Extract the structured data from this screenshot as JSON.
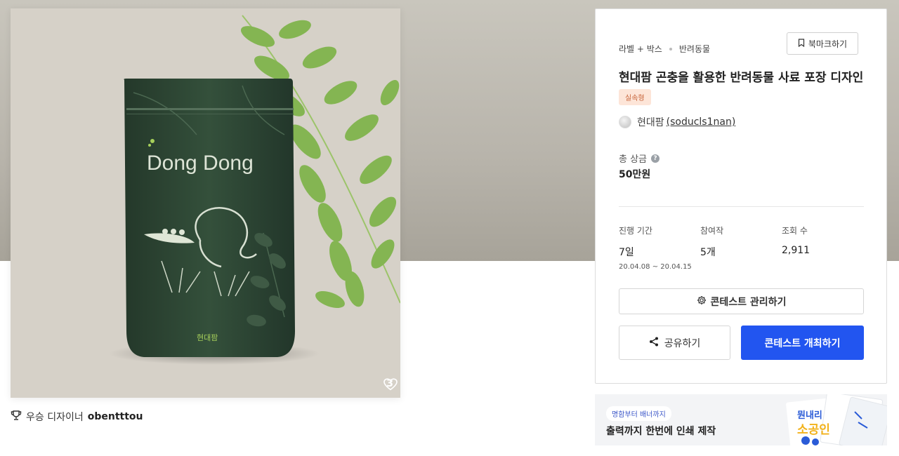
{
  "hero": {
    "brand_text": "Dong Dong",
    "logo_text": "현대팜",
    "like_count": "3"
  },
  "winner": {
    "label": "우승 디자이너",
    "name": "obentttou"
  },
  "panel": {
    "breadcrumb": [
      "라벨 + 박스",
      "반려동물"
    ],
    "bookmark_label": "북마크하기",
    "title": "현대팜 곤충을 활용한 반려동물 사료 포장 디자인",
    "badge": "실속형",
    "author_name": "현대팜",
    "author_handle": "(soducls1nan)",
    "prize_label": "총 상금",
    "prize_help": "?",
    "prize_value": "50만원",
    "stats": [
      {
        "label": "진행 기간",
        "value": "7일",
        "sub": "20.04.08 ~ 20.04.15"
      },
      {
        "label": "참여작",
        "value": "5개"
      },
      {
        "label": "조회 수",
        "value": "2,911"
      }
    ],
    "manage_label": "콘테스트 관리하기",
    "share_label": "공유하기",
    "host_label": "콘테스트 개최하기"
  },
  "banner": {
    "tag": "명함부터 배너까지",
    "text": "출력까지 한번에 인쇄 제작",
    "art_line1": "뭔내리",
    "art_line2": "소공인"
  },
  "icons": {
    "like": "heart-icon",
    "trophy": "trophy-icon",
    "bookmark": "bookmark-icon",
    "gear": "gear-icon",
    "share": "share-icon"
  },
  "colors": {
    "primary": "#2255f0",
    "badge_bg": "#fde5d8",
    "badge_text": "#c7643a",
    "bag": "#2e4533",
    "leaf": "#7fb04a"
  }
}
